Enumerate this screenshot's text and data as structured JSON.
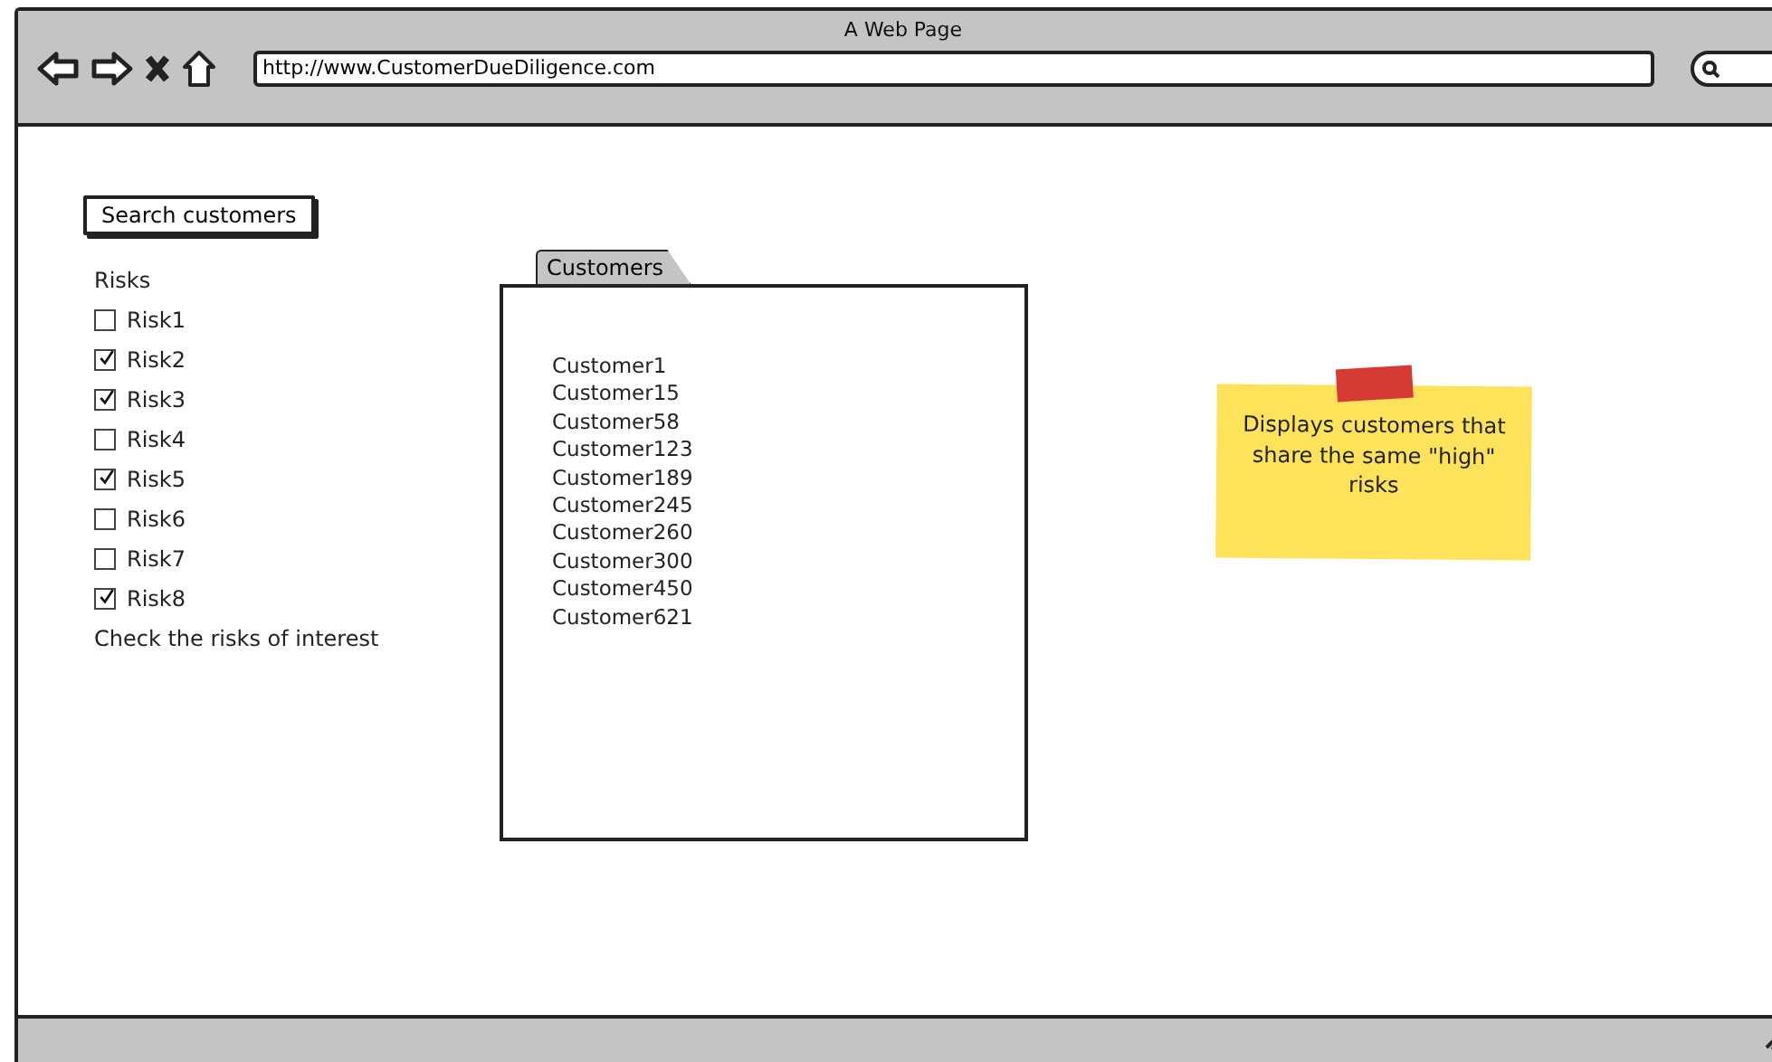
{
  "window": {
    "title": "A Web Page",
    "url": "http://www.CustomerDueDiligence.com"
  },
  "search_button": "Search customers",
  "risks": {
    "label": "Risks",
    "items": [
      {
        "label": "Risk1",
        "checked": false
      },
      {
        "label": "Risk2",
        "checked": true
      },
      {
        "label": "Risk3",
        "checked": true
      },
      {
        "label": "Risk4",
        "checked": false
      },
      {
        "label": "Risk5",
        "checked": true
      },
      {
        "label": "Risk6",
        "checked": false
      },
      {
        "label": "Risk7",
        "checked": false
      },
      {
        "label": "Risk8",
        "checked": true
      }
    ],
    "hint": "Check the risks of interest"
  },
  "tabs": [
    {
      "label": "Customers",
      "selected": true
    }
  ],
  "customers": [
    "Customer1",
    "Customer15",
    "Customer58",
    "Customer123",
    "Customer189",
    "Customer245",
    "Customer260",
    "Customer300",
    "Customer450",
    "Customer621"
  ],
  "note": "Displays customers that share the same \"high\" risks"
}
